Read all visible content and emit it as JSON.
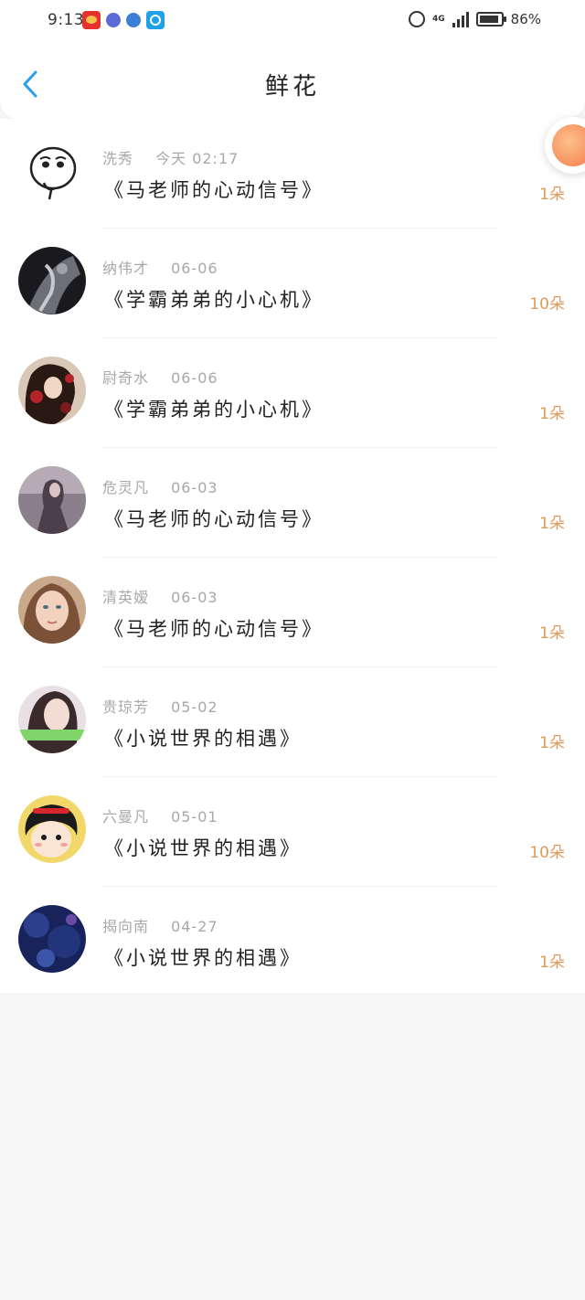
{
  "status_bar": {
    "time": "9:13",
    "network": "4G",
    "battery": "86%"
  },
  "header": {
    "title": "鲜花"
  },
  "items": [
    {
      "sender": "洗秀",
      "date": "今天 02:17",
      "book": "《马老师的心动信号》",
      "count": "1朵"
    },
    {
      "sender": "纳伟才",
      "date": "06-06",
      "book": "《学霸弟弟的小心机》",
      "count": "10朵"
    },
    {
      "sender": "尉奇水",
      "date": "06-06",
      "book": "《学霸弟弟的小心机》",
      "count": "1朵"
    },
    {
      "sender": "危灵凡",
      "date": "06-03",
      "book": "《马老师的心动信号》",
      "count": "1朵"
    },
    {
      "sender": "清英嫒",
      "date": "06-03",
      "book": "《马老师的心动信号》",
      "count": "1朵"
    },
    {
      "sender": "贵琼芳",
      "date": "05-02",
      "book": "《小说世界的相遇》",
      "count": "1朵"
    },
    {
      "sender": "六曼凡",
      "date": "05-01",
      "book": "《小说世界的相遇》",
      "count": "10朵"
    },
    {
      "sender": "揭向南",
      "date": "04-27",
      "book": "《小说世界的相遇》",
      "count": "1朵"
    }
  ],
  "colors": {
    "accent": "#2d9ee9",
    "count": "#e09a5c",
    "meta": "#a8a8a8"
  }
}
